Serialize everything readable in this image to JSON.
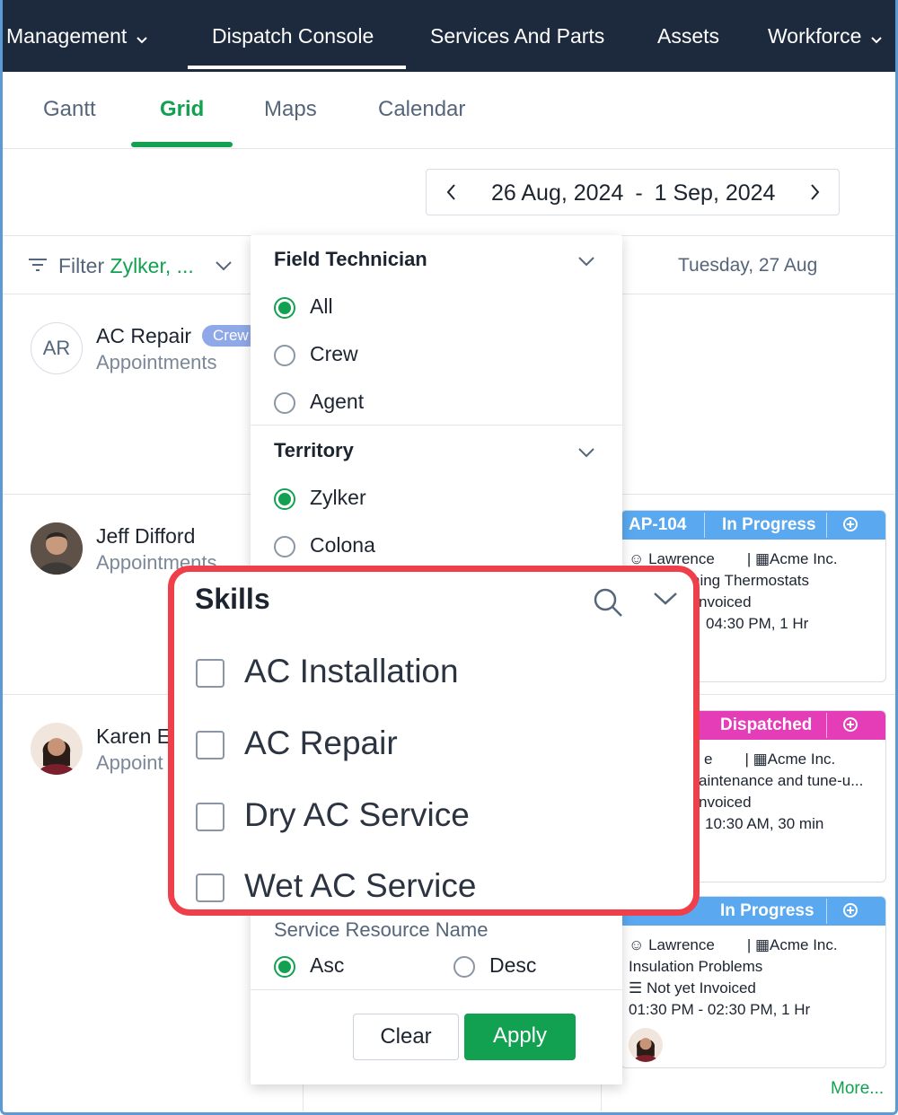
{
  "topnav": {
    "items": [
      {
        "label": "Management",
        "has_chevron": true
      },
      {
        "label": "Dispatch Console",
        "has_chevron": false,
        "active": true
      },
      {
        "label": "Services And Parts",
        "has_chevron": false
      },
      {
        "label": "Assets",
        "has_chevron": false
      },
      {
        "label": "Workforce",
        "has_chevron": true
      }
    ]
  },
  "tabs": [
    {
      "label": "Gantt"
    },
    {
      "label": "Grid",
      "active": true
    },
    {
      "label": "Maps"
    },
    {
      "label": "Calendar"
    }
  ],
  "date_range": {
    "start": "26 Aug, 2024",
    "sep": "-",
    "end": "1 Sep, 2024"
  },
  "filter": {
    "label": "Filter",
    "value": "Zylker, ..."
  },
  "day_header": "Tuesday, 27 Aug",
  "resources": [
    {
      "initials": "AR",
      "name": "AC Repair",
      "badge": "Crew",
      "sub": "Appointments"
    },
    {
      "name": "Jeff Difford",
      "sub": "Appointments"
    },
    {
      "name": "Karen E",
      "sub": "Appoint"
    }
  ],
  "cards": [
    {
      "id": "AP-104",
      "status": "In Progress",
      "color": "#5aa9f0",
      "lines": [
        "Lawrence",
        "Acme Inc.",
        "ning Thermostats",
        "nvoiced",
        "04:30 PM, 1 Hr"
      ]
    },
    {
      "status": "Dispatched",
      "color": "#e43db7",
      "lines": [
        "e",
        "Acme Inc.",
        "aintenance and tune-u...",
        "nvoiced",
        "10:30 AM, 30 min"
      ]
    },
    {
      "status": "In Progress",
      "color": "#5aa9f0",
      "lines": [
        "Lawrence",
        "Acme Inc.",
        "Insulation Problems",
        "Not yet Invoiced",
        "01:30 PM - 02:30 PM, 1 Hr"
      ]
    }
  ],
  "more_link": "More...",
  "panel": {
    "field_technician": {
      "title": "Field Technician",
      "options": [
        "All",
        "Crew",
        "Agent"
      ],
      "selected": "All"
    },
    "territory": {
      "title": "Territory",
      "options": [
        "Zylker",
        "Colona"
      ],
      "selected": "Zylker"
    },
    "sort": {
      "title": "Service Resource Name",
      "options": [
        "Asc",
        "Desc"
      ],
      "selected": "Asc"
    },
    "clear_label": "Clear",
    "apply_label": "Apply"
  },
  "skills": {
    "title": "Skills",
    "items": [
      "AC Installation",
      "AC Repair",
      "Dry AC Service",
      "Wet AC Service"
    ]
  },
  "colors": {
    "nav_bg": "#1d2a3d",
    "accent": "#12a150",
    "highlight": "#ef3f4a"
  }
}
